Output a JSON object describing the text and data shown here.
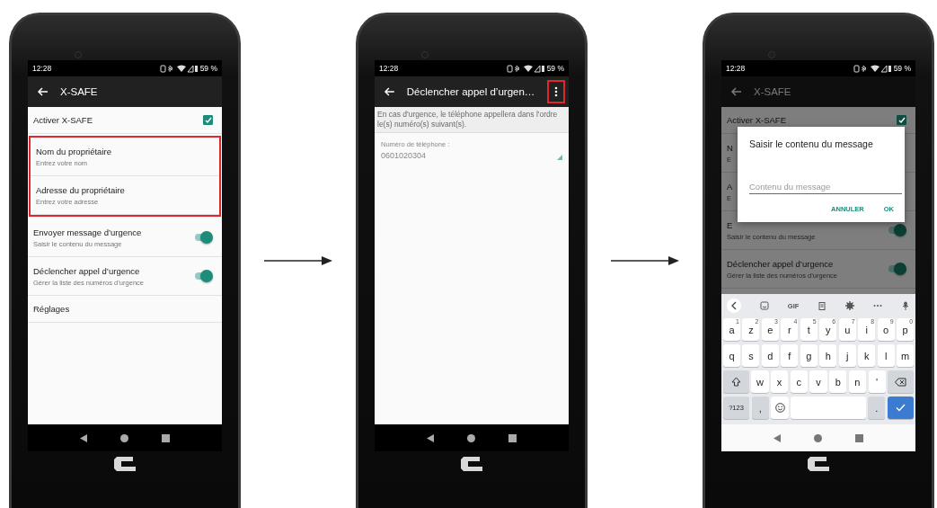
{
  "phones": [
    {
      "kind": "settings",
      "dimmed": false,
      "status_bar": {
        "time": "12:28",
        "battery": "59 %"
      },
      "app_bar": {
        "title": "X-SAFE"
      },
      "items": [
        {
          "title": "Activer X-SAFE",
          "kind": "checkbox",
          "checked": true,
          "highlighted": false
        },
        {
          "title": "Nom du propriétaire",
          "summary": "Entrez votre nom",
          "kind": "plain",
          "highlighted": true
        },
        {
          "title": "Adresse du propriétaire",
          "summary": "Entrez votre adresse",
          "kind": "plain",
          "highlighted": true
        },
        {
          "title": "Envoyer message d’urgence",
          "summary": "Saisir le contenu du message",
          "kind": "switch",
          "checked": true,
          "highlighted": false
        },
        {
          "title": "Déclencher appel d’urgence",
          "summary": "Gérer la liste des numéros d’urgence",
          "kind": "switch",
          "checked": true,
          "highlighted": false
        },
        {
          "title": "Réglages",
          "kind": "plain",
          "highlighted": false
        }
      ],
      "nav_bar": {
        "light": false
      }
    },
    {
      "kind": "list_editor",
      "status_bar": {
        "time": "12:28",
        "battery": "59 %"
      },
      "app_bar": {
        "title": "Déclencher appel d’urgen…",
        "menu": {
          "highlighted": true
        }
      },
      "description": "En cas d'urgence, le téléphone appellera dans l'ordre le(s) numéro(s) suivant(s).",
      "field": {
        "label": "Numéro de téléphone :",
        "value": "0601020304"
      },
      "nav_bar": {
        "light": false
      }
    },
    {
      "kind": "settings",
      "dimmed": true,
      "status_bar": {
        "time": "12:28",
        "battery": "59 %"
      },
      "app_bar": {
        "title": "X-SAFE"
      },
      "items": [
        {
          "title": "Activer X-SAFE",
          "kind": "checkbox",
          "checked": true,
          "highlighted": false
        },
        {
          "title": "N",
          "summary": "E",
          "kind": "plain",
          "highlighted": false
        },
        {
          "title": "A",
          "summary": "E",
          "kind": "plain",
          "highlighted": false
        },
        {
          "title": "E",
          "summary": "Saisir le contenu du message",
          "kind": "switch",
          "checked": true,
          "highlighted": false
        },
        {
          "title": "Déclencher appel d’urgence",
          "summary": "Gérer la liste des numéros d’urgence",
          "kind": "switch",
          "checked": true,
          "highlighted": false
        }
      ],
      "dialog": {
        "title": "Saisir le contenu du message",
        "placeholder": "Contenu du message",
        "buttons": [
          "ANNULER",
          "OK"
        ]
      },
      "keyboard": {
        "toolbar": [
          {
            "kind": "back"
          },
          {
            "kind": "sticker"
          },
          {
            "kind": "gif",
            "label": "GIF"
          },
          {
            "kind": "clipboard"
          },
          {
            "kind": "settings"
          },
          {
            "kind": "more"
          },
          {
            "kind": "mic"
          }
        ],
        "rows": [
          [
            {
              "kind": "char",
              "label": "a",
              "hint": "1"
            },
            {
              "kind": "char",
              "label": "z",
              "hint": "2"
            },
            {
              "kind": "char",
              "label": "e",
              "hint": "3"
            },
            {
              "kind": "char",
              "label": "r",
              "hint": "4"
            },
            {
              "kind": "char",
              "label": "t",
              "hint": "5"
            },
            {
              "kind": "char",
              "label": "y",
              "hint": "6"
            },
            {
              "kind": "char",
              "label": "u",
              "hint": "7"
            },
            {
              "kind": "char",
              "label": "i",
              "hint": "8"
            },
            {
              "kind": "char",
              "label": "o",
              "hint": "9"
            },
            {
              "kind": "char",
              "label": "p",
              "hint": "0"
            }
          ],
          [
            {
              "kind": "char",
              "label": "q"
            },
            {
              "kind": "char",
              "label": "s"
            },
            {
              "kind": "char",
              "label": "d"
            },
            {
              "kind": "char",
              "label": "f"
            },
            {
              "kind": "char",
              "label": "g"
            },
            {
              "kind": "char",
              "label": "h"
            },
            {
              "kind": "char",
              "label": "j"
            },
            {
              "kind": "char",
              "label": "k"
            },
            {
              "kind": "char",
              "label": "l"
            },
            {
              "kind": "char",
              "label": "m"
            }
          ],
          [
            {
              "kind": "shift"
            },
            {
              "kind": "char",
              "label": "w"
            },
            {
              "kind": "char",
              "label": "x"
            },
            {
              "kind": "char",
              "label": "c"
            },
            {
              "kind": "char",
              "label": "v"
            },
            {
              "kind": "char",
              "label": "b"
            },
            {
              "kind": "char",
              "label": "n"
            },
            {
              "kind": "char",
              "label": "'"
            },
            {
              "kind": "backspace"
            }
          ],
          [
            {
              "kind": "symbols",
              "label": "?123"
            },
            {
              "kind": "punct",
              "label": ","
            },
            {
              "kind": "emoji"
            },
            {
              "kind": "space"
            },
            {
              "kind": "punct",
              "label": "."
            },
            {
              "kind": "enter"
            }
          ]
        ]
      },
      "nav_bar": {
        "light": true
      }
    }
  ]
}
